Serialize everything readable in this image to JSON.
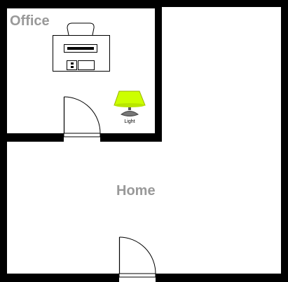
{
  "plan": {
    "rooms": [
      {
        "name": "Office"
      },
      {
        "name": "Home"
      }
    ],
    "fixtures": {
      "light": {
        "label": "Light",
        "color": "#ccff00"
      }
    }
  },
  "colors": {
    "wall": "#000000",
    "label": "#999999",
    "background": "#ffffff",
    "light_shade": "#ccff00",
    "light_base": "#777777"
  }
}
